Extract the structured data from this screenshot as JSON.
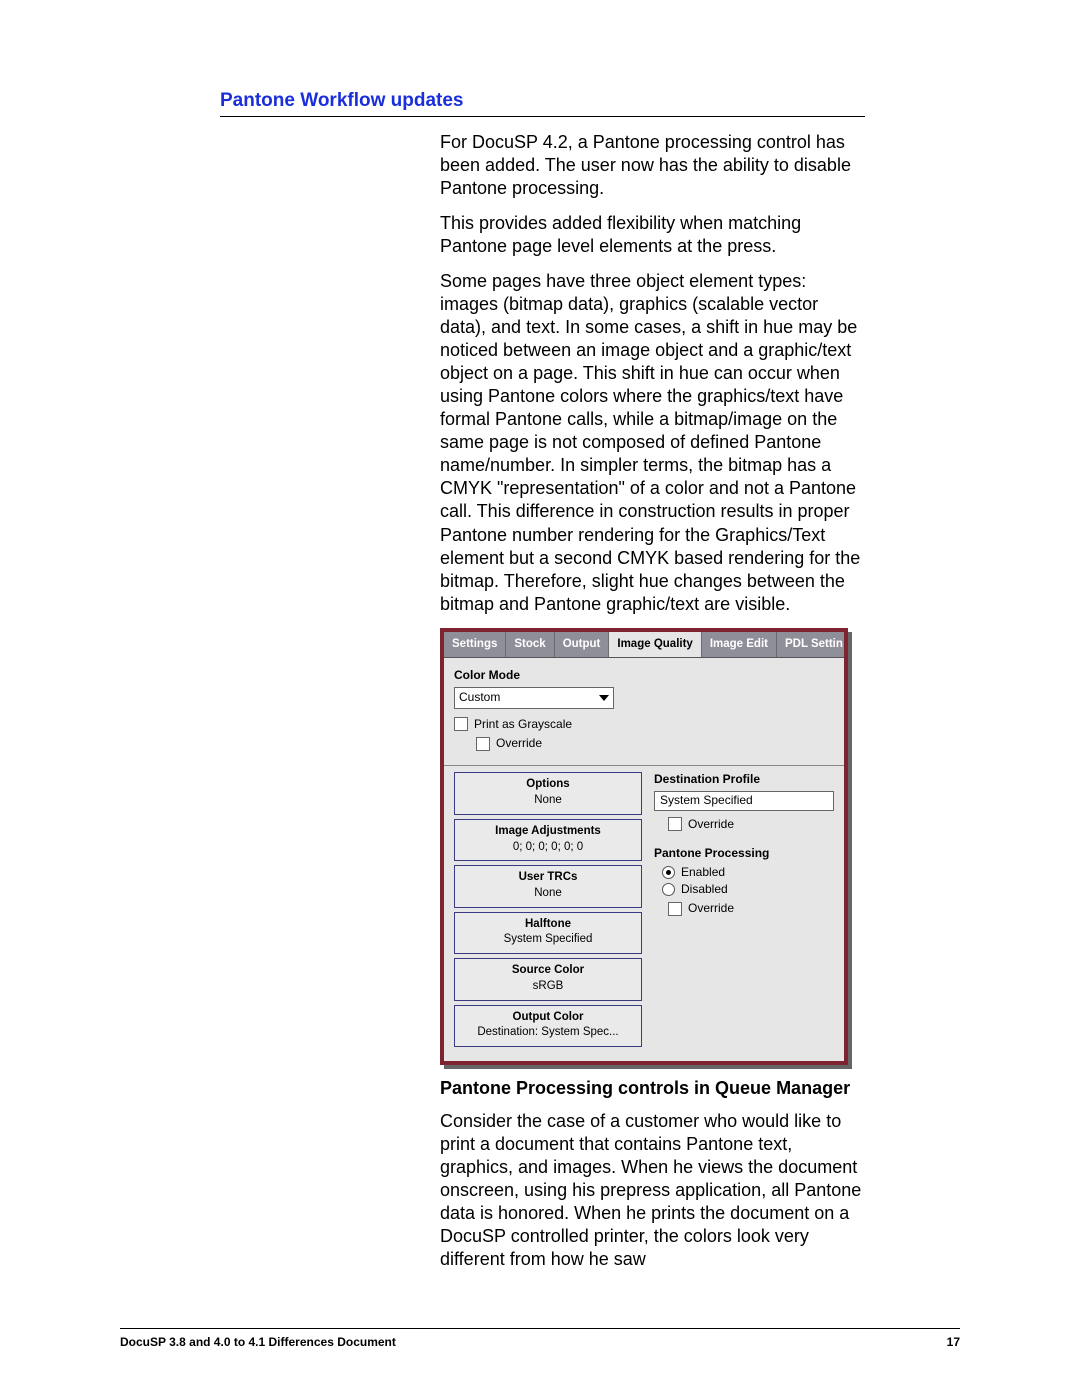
{
  "section_title": "Pantone Workflow updates",
  "paragraphs": {
    "p1": "For DocuSP 4.2, a Pantone processing control has been added. The user now has the ability to disable Pantone processing.",
    "p2": "This provides added flexibility when matching Pantone page level elements at the press.",
    "p3": "Some pages have three object element types: images (bitmap data), graphics (scalable vector data), and text. In some cases, a shift in hue may be noticed between an image object and a graphic/text object on a page. This shift in hue can occur when using Pantone colors where the graphics/text have formal Pantone calls, while a bitmap/image on the same page is not composed of defined Pantone name/number. In simpler terms, the bitmap has a CMYK \"representation\" of a color and not a Pantone call. This difference in construction results in proper Pantone number rendering for the Graphics/Text element but a second CMYK based rendering for the bitmap. Therefore, slight hue changes between the bitmap and Pantone graphic/text are visible."
  },
  "dialog": {
    "tabs": {
      "settings": "Settings",
      "stock": "Stock",
      "output": "Output",
      "image_quality": "Image Quality",
      "image_edit": "Image Edit",
      "pdl": "PDL Settin"
    },
    "color_mode_label": "Color Mode",
    "color_mode_value": "Custom",
    "print_grayscale": "Print as Grayscale",
    "override": "Override",
    "left_cells": {
      "options": {
        "hdr": "Options",
        "val": "None"
      },
      "imgadj": {
        "hdr": "Image Adjustments",
        "val": "0; 0; 0; 0; 0; 0"
      },
      "trc": {
        "hdr": "User TRCs",
        "val": "None"
      },
      "halftone": {
        "hdr": "Halftone",
        "val": "System Specified"
      },
      "src": {
        "hdr": "Source Color",
        "val": "sRGB"
      },
      "out": {
        "hdr": "Output Color",
        "val": "Destination: System Spec..."
      }
    },
    "dest_profile_label": "Destination Profile",
    "dest_profile_value": "System Specified",
    "pantone_label": "Pantone Processing",
    "pantone_enabled": "Enabled",
    "pantone_disabled": "Disabled"
  },
  "caption": "Pantone Processing controls in Queue Manager",
  "paragraph_after": "Consider the case of a customer who would like to print a document that contains Pantone text, graphics, and images. When he views the document onscreen, using his prepress application, all Pantone data is honored. When he prints the document on a DocuSP controlled printer, the colors look very different from how he saw",
  "footer": {
    "left": "DocuSP 3.8 and 4.0 to 4.1 Differences Document",
    "right": "17"
  }
}
